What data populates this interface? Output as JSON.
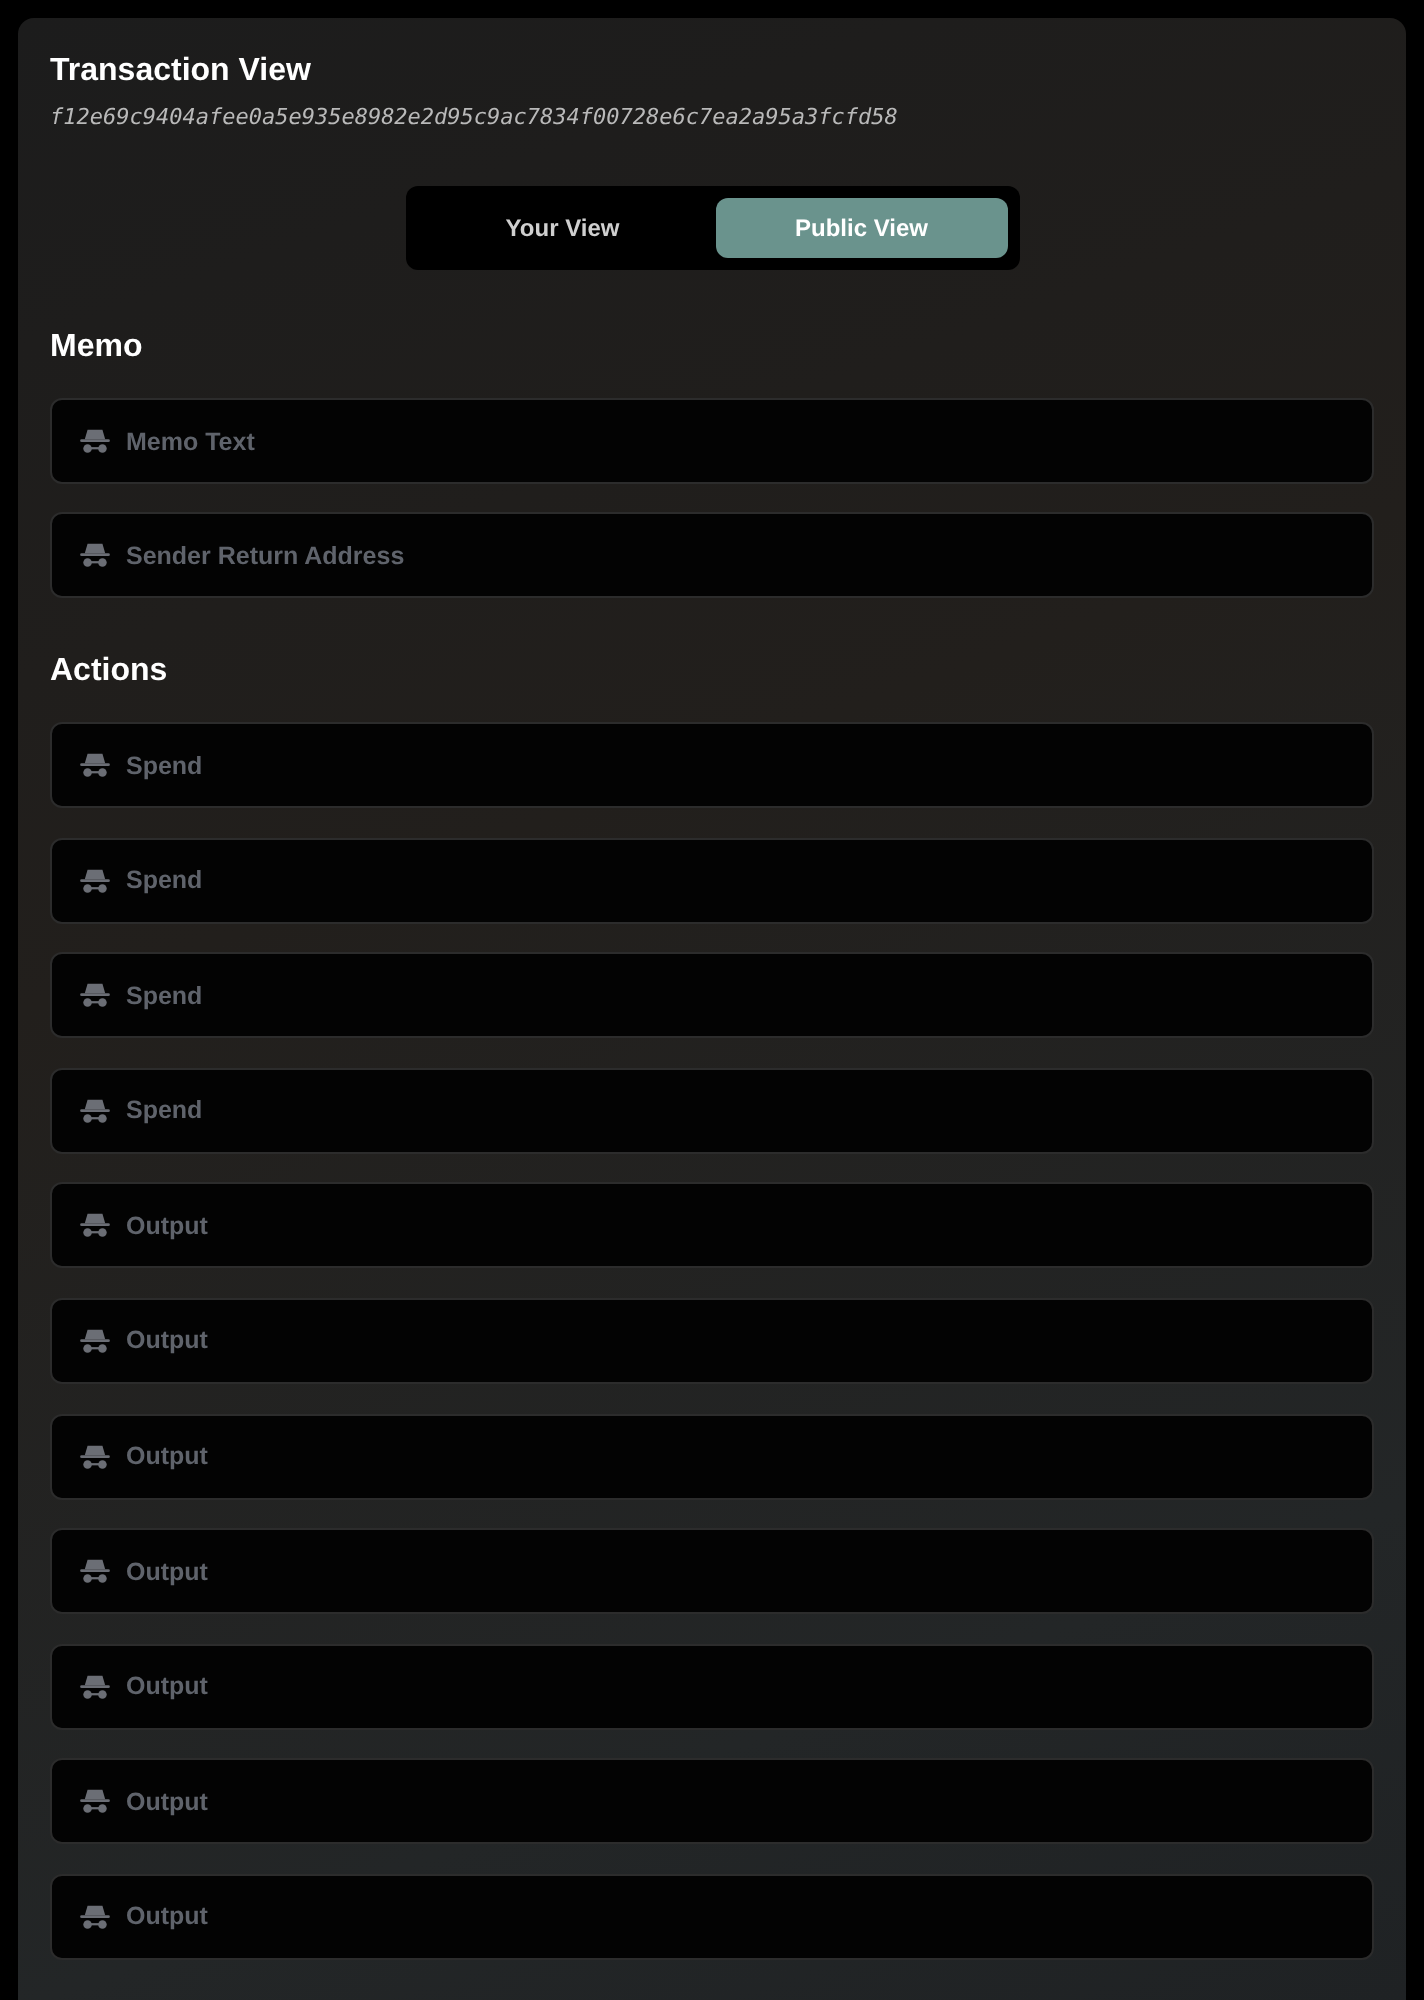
{
  "card": {
    "title": "Transaction View",
    "hash": "f12e69c9404afee0a5e935e8982e2d95c9ac7834f00728e6c7ea2a95a3fcfd58"
  },
  "view_toggle": [
    {
      "label": "Your View",
      "selected": false
    },
    {
      "label": "Public View",
      "selected": true
    }
  ],
  "sections": [
    {
      "heading": "Memo",
      "rows": [
        "Memo Text",
        "Sender Return Address"
      ]
    },
    {
      "heading": "Actions",
      "rows": [
        "Spend",
        "Spend",
        "Spend",
        "Spend",
        "Output",
        "Output",
        "Output",
        "Output",
        "Output",
        "Output",
        "Output"
      ]
    }
  ]
}
